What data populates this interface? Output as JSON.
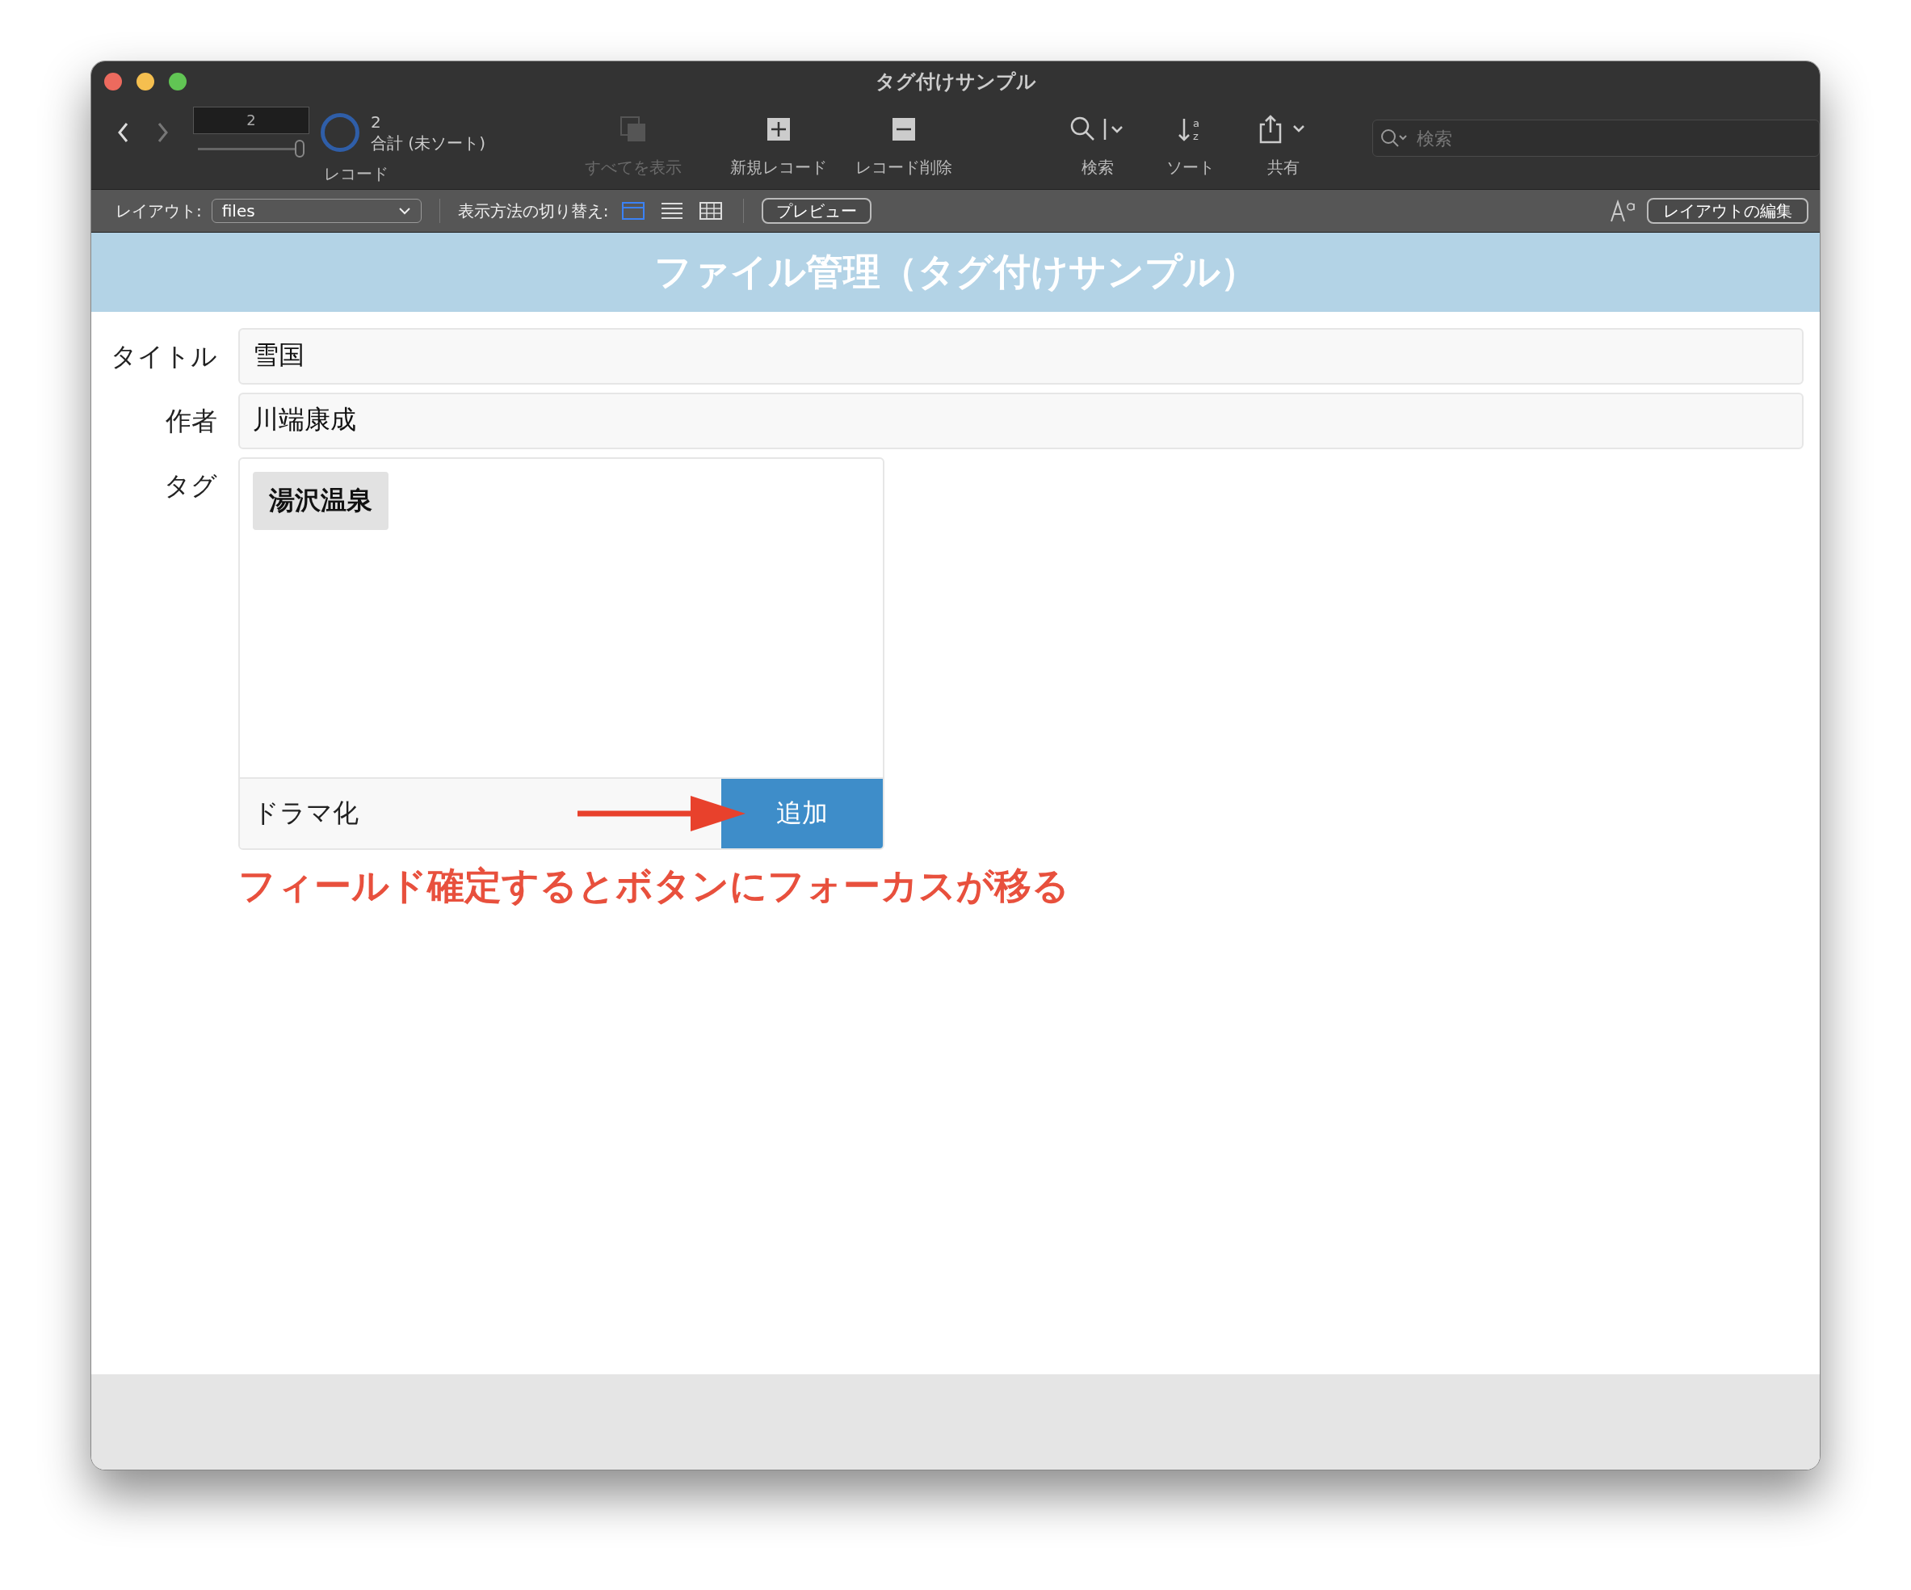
{
  "window": {
    "title": "タグ付けサンプル"
  },
  "toolbar": {
    "record_number": "2",
    "record_slider": {
      "level": 1
    },
    "record_count": "2",
    "record_total_label": "合計 (未ソート)",
    "record_label": "レコード",
    "buttons": [
      {
        "label": "すべてを表示",
        "kind": "show-all",
        "disabled": true
      },
      {
        "label": "新規レコード",
        "kind": "new",
        "disabled": false
      },
      {
        "label": "レコード削除",
        "kind": "delete",
        "disabled": false
      },
      {
        "label": "検索",
        "kind": "find",
        "disabled": false
      },
      {
        "label": "ソート",
        "kind": "sort",
        "disabled": false,
        "icon_letters": [
          "a",
          "z"
        ]
      },
      {
        "label": "共有",
        "kind": "share",
        "disabled": false
      }
    ],
    "search": {
      "placeholder": "検索"
    }
  },
  "layout_bar": {
    "layout_label": "レイアウト:",
    "layout_value": "files",
    "view_label": "表示方法の切り替え:",
    "views": [
      {
        "kind": "form",
        "selected": true
      },
      {
        "kind": "list",
        "selected": false
      },
      {
        "kind": "table",
        "selected": false
      }
    ],
    "preview_button": "プレビュー",
    "edit_layout_button": "レイアウトの編集"
  },
  "header": {
    "title": "ファイル管理（タグ付けサンプル）"
  },
  "form": {
    "fields": [
      {
        "label": "タイトル",
        "value": "雪国"
      },
      {
        "label": "作者",
        "value": "川端康成"
      }
    ],
    "tags": {
      "label": "タグ",
      "items": [
        "湯沢温泉"
      ],
      "input_value": "ドラマ化",
      "add_button": "追加"
    }
  },
  "annotation": {
    "text": "フィールド確定するとボタンにフォーカスが移る"
  }
}
